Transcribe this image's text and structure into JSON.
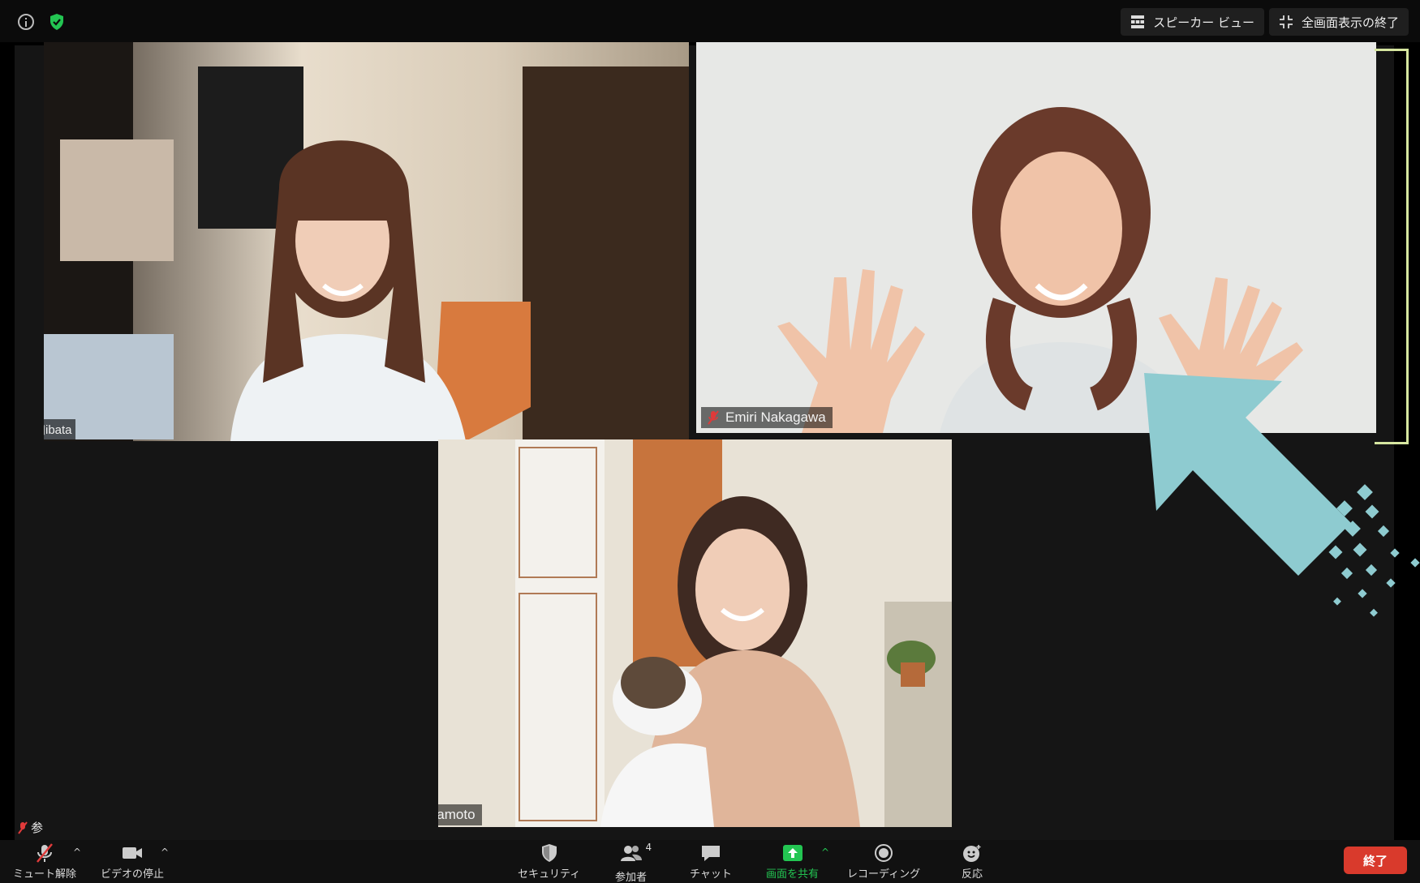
{
  "topbar": {
    "speaker_view_label": "スピーカー ビュー",
    "exit_fullscreen_label": "全画面表示の終了"
  },
  "participants": [
    {
      "name": "",
      "partial_label": "参加ibata"
    },
    {
      "name": "Emiri Nakagawa"
    },
    {
      "name": "Shuko Yamamoto"
    }
  ],
  "bottom_left_label": "参",
  "toolbar": {
    "unmute_label": "ミュート解除",
    "stop_video_label": "ビデオの停止",
    "security_label": "セキュリティ",
    "participants_label": "参加者",
    "participants_count": "4",
    "chat_label": "チャット",
    "share_screen_label": "画面を共有",
    "recording_label": "レコーディング",
    "reactions_label": "反応",
    "end_label": "終了"
  },
  "colors": {
    "share_green": "#23c552",
    "end_red": "#d93a2c",
    "arrow_teal": "#8ecbd0",
    "speaker_highlight": "#d6e6a0"
  }
}
